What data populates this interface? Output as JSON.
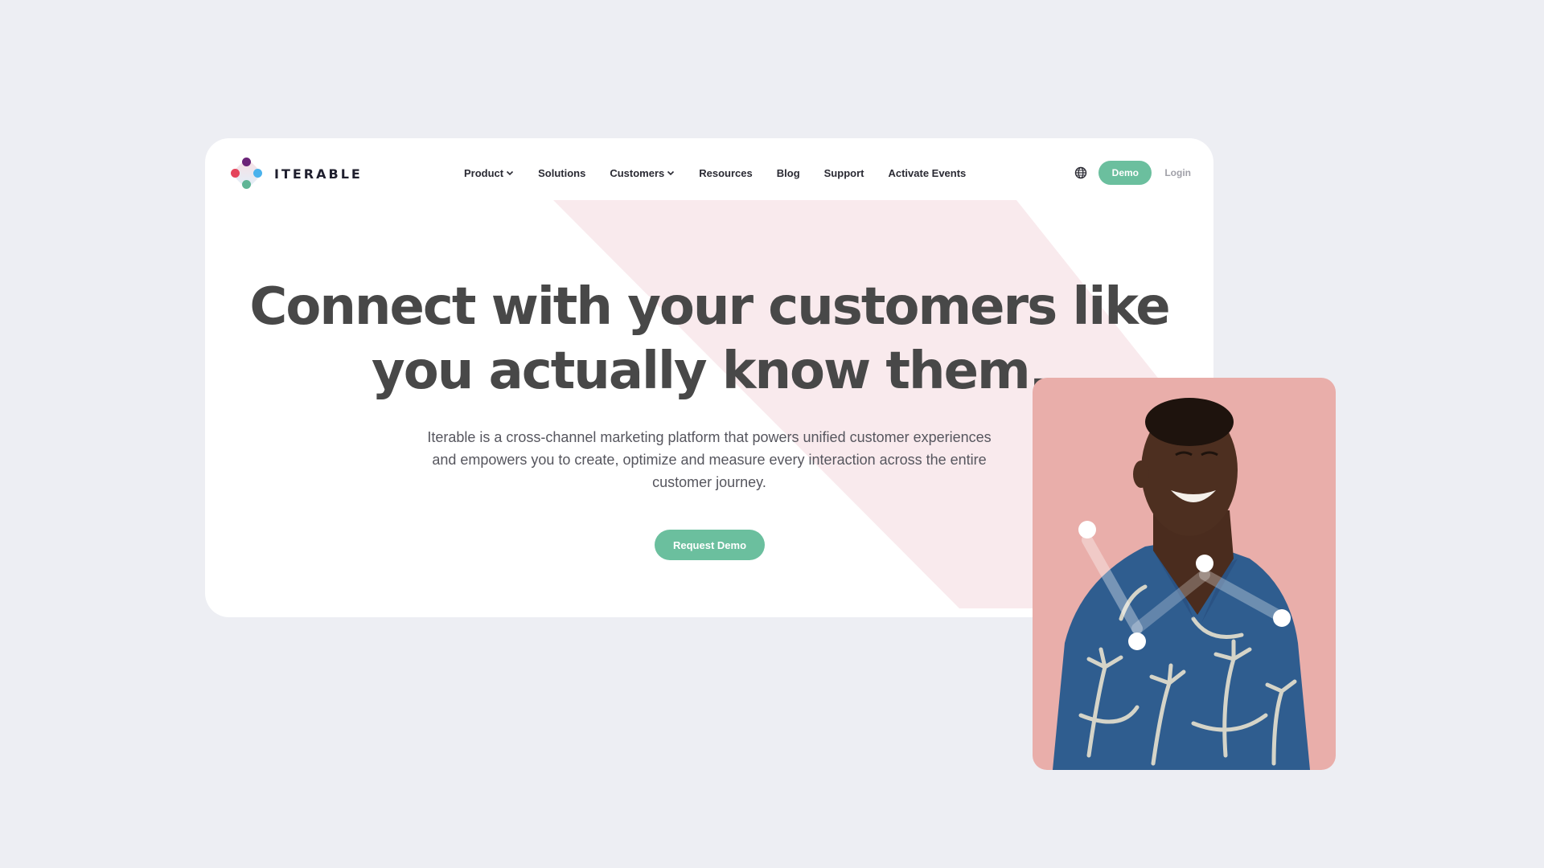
{
  "brand": {
    "name": "ITERABLE",
    "logo_icon": "iterable-diamond-logo-icon",
    "colors": {
      "accent": "#6bbf9e",
      "logo_purple": "#6b2478",
      "logo_red": "#e4445b",
      "logo_blue": "#4ab2ec",
      "logo_green": "#5fb596",
      "hero_pink": "#f9eaed",
      "photo_bg": "#e9aeaa",
      "page_bg": "#edeef3"
    }
  },
  "nav": {
    "items": [
      {
        "label": "Product",
        "has_dropdown": true
      },
      {
        "label": "Solutions",
        "has_dropdown": false
      },
      {
        "label": "Customers",
        "has_dropdown": true
      },
      {
        "label": "Resources",
        "has_dropdown": false
      },
      {
        "label": "Blog",
        "has_dropdown": false
      },
      {
        "label": "Support",
        "has_dropdown": false
      },
      {
        "label": "Activate Events",
        "has_dropdown": false
      }
    ],
    "language_icon": "globe-icon",
    "demo_label": "Demo",
    "login_label": "Login"
  },
  "hero": {
    "headline_line1": "Connect with your customers like",
    "headline_line2": "you actually know them.",
    "description": "Iterable is a cross-channel marketing platform that powers unified customer experiences and empowers you to create, optimize and measure every interaction across the entire customer journey.",
    "cta_label": "Request Demo"
  },
  "photo": {
    "description": "Smiling man in a blue palm-print shirt on a pink background with white connection dots"
  }
}
